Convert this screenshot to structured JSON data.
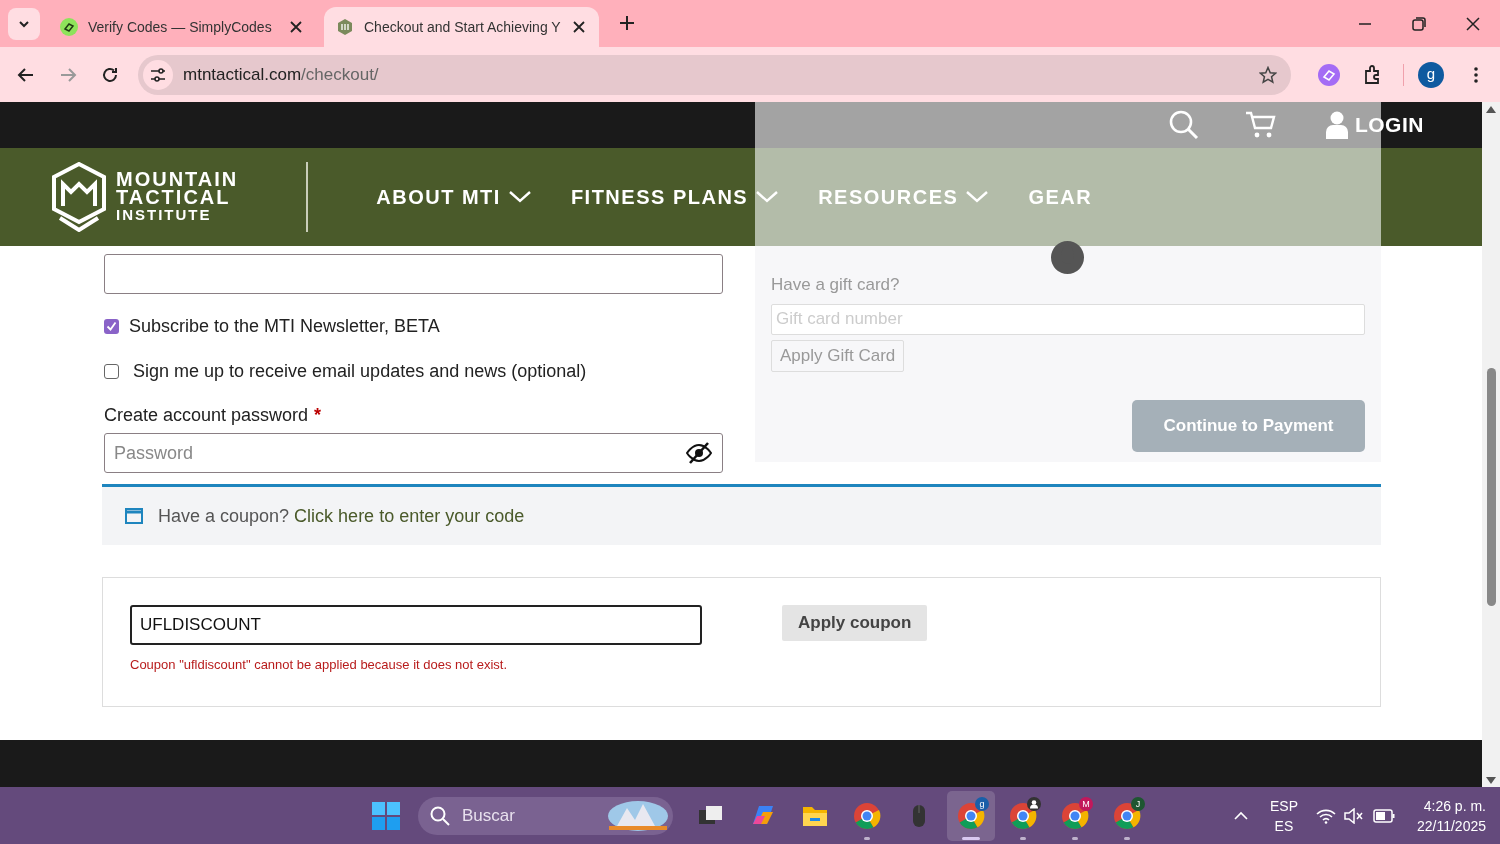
{
  "browser": {
    "tabs": [
      {
        "title": "Verify Codes — SimplyCodes",
        "selected": false
      },
      {
        "title": "Checkout and Start Achieving Y",
        "selected": true
      }
    ],
    "address": {
      "domain": "mtntactical.com",
      "path": "/checkout/"
    },
    "profile_initial": "g"
  },
  "site_header": {
    "logo_lines": [
      "MOUNTAIN",
      "TACTICAL",
      "INSTITUTE"
    ],
    "login": "LOGIN",
    "nav": [
      {
        "label": "ABOUT MTI",
        "dropdown": true
      },
      {
        "label": "FITNESS PLANS",
        "dropdown": true
      },
      {
        "label": "RESOURCES",
        "dropdown": true
      },
      {
        "label": "GEAR",
        "dropdown": false
      }
    ]
  },
  "checkout": {
    "checkboxes": [
      {
        "label": "Subscribe to the MTI Newsletter, BETA",
        "checked": true
      },
      {
        "label": "Sign me up to receive email updates and news (optional)",
        "checked": false
      }
    ],
    "password": {
      "label": "Create account password",
      "required_mark": "*",
      "placeholder": "Password"
    },
    "gift_card": {
      "heading": "Have a gift card?",
      "placeholder": "Gift card number",
      "button": "Apply Gift Card"
    },
    "continue_button": "Continue to Payment",
    "coupon_notice": {
      "text": "Have a coupon?",
      "link": "Click here to enter your code"
    },
    "coupon_form": {
      "value": "UFLDISCOUNT",
      "button": "Apply coupon",
      "error": "Coupon \"ufldiscount\" cannot be applied because it does not exist."
    }
  },
  "taskbar": {
    "search_placeholder": "Buscar",
    "apps": [
      {
        "kind": "task-view",
        "running": false,
        "selected": false
      },
      {
        "kind": "copilot",
        "running": false,
        "selected": false
      },
      {
        "kind": "folder",
        "running": false,
        "selected": false
      },
      {
        "kind": "chrome",
        "running": true,
        "selected": false
      },
      {
        "kind": "mouse",
        "running": false,
        "selected": false
      },
      {
        "kind": "chrome",
        "running": true,
        "selected": true,
        "badge": "g",
        "color": "#1a5fa8"
      },
      {
        "kind": "chrome-person",
        "running": true,
        "selected": false
      },
      {
        "kind": "chrome",
        "running": true,
        "selected": false,
        "badge": "M",
        "color": "#c2185b"
      },
      {
        "kind": "chrome",
        "running": true,
        "selected": false,
        "badge": "J",
        "color": "#1e5631"
      }
    ],
    "language": "ESP",
    "layout": "ES",
    "time": "4:26 p. m.",
    "date": "22/11/2025"
  }
}
